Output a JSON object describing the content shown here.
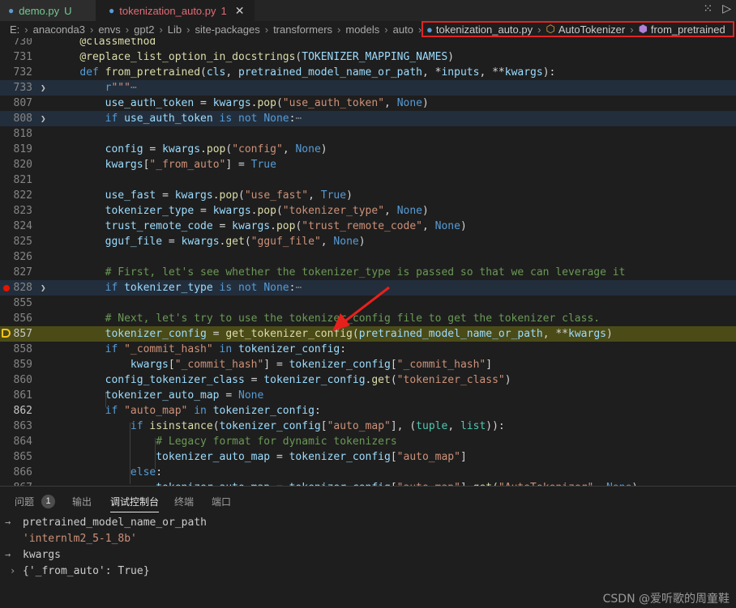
{
  "tabs": [
    {
      "name": "demo.py",
      "marker": "U"
    },
    {
      "name": "tokenization_auto.py",
      "marker": "1"
    }
  ],
  "breadcrumb": [
    "E:",
    "anaconda3",
    "envs",
    "gpt2",
    "Lib",
    "site-packages",
    "transformers",
    "models",
    "auto"
  ],
  "breadcrumb_highlight": {
    "file": "tokenization_auto.py",
    "class": "AutoTokenizer",
    "method": "from_pretrained"
  },
  "editor_lines": [
    {
      "n": "730"
    },
    {
      "n": "731"
    },
    {
      "n": "732"
    },
    {
      "n": "733"
    },
    {
      "n": "807"
    },
    {
      "n": "808"
    },
    {
      "n": "818"
    },
    {
      "n": "819"
    },
    {
      "n": "820"
    },
    {
      "n": "821"
    },
    {
      "n": "822"
    },
    {
      "n": "823"
    },
    {
      "n": "824"
    },
    {
      "n": "825"
    },
    {
      "n": "826"
    },
    {
      "n": "827"
    },
    {
      "n": "828"
    },
    {
      "n": "855"
    },
    {
      "n": "856"
    },
    {
      "n": "857"
    },
    {
      "n": "858"
    },
    {
      "n": "859"
    },
    {
      "n": "860"
    },
    {
      "n": "861"
    },
    {
      "n": "862"
    },
    {
      "n": "863"
    },
    {
      "n": "864"
    },
    {
      "n": "865"
    },
    {
      "n": "866"
    },
    {
      "n": "867"
    }
  ],
  "panel": {
    "tabs": [
      "问题",
      "输出",
      "调试控制台",
      "终端",
      "端口"
    ],
    "problems_count": "1",
    "console": [
      "pretrained_model_name_or_path",
      "'internlm2_5-1_8b'",
      "kwargs",
      "{'_from_auto': True}"
    ]
  },
  "watermark": "CSDN @爱听歌的周童鞋"
}
